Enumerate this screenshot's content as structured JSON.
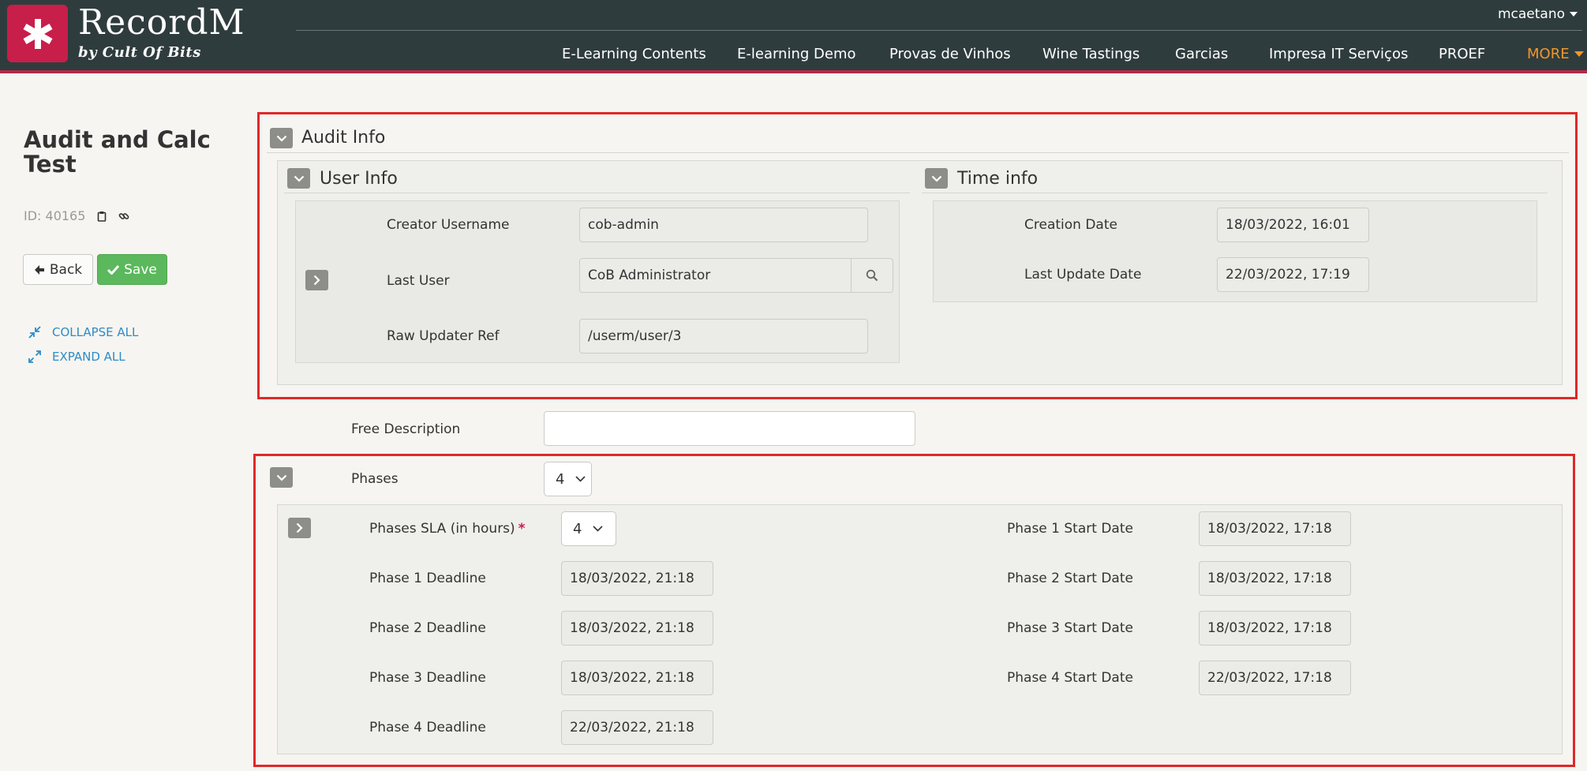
{
  "header": {
    "brand": "RecordM",
    "tagline": "by Cult Of Bits",
    "user": "mcaetano",
    "nav": [
      {
        "label": "E-Learning Contents"
      },
      {
        "label": "E-learning Demo"
      },
      {
        "label": "Provas de Vinhos"
      },
      {
        "label": "Wine Tastings"
      },
      {
        "label": "Garcias"
      },
      {
        "label": "Impresa IT Serviços"
      },
      {
        "label": "PROEF"
      }
    ],
    "more_label": "MORE"
  },
  "sidebar": {
    "title": "Audit and Calc Test",
    "id_label": "ID: 40165",
    "back_label": "Back",
    "save_label": "Save",
    "collapse_all": "COLLAPSE ALL",
    "expand_all": "EXPAND ALL"
  },
  "audit": {
    "title": "Audit Info",
    "user_info": {
      "title": "User Info",
      "creator_label": "Creator Username",
      "creator_value": "cob-admin",
      "last_user_label": "Last User",
      "last_user_value": "CoB Administrator",
      "raw_ref_label": "Raw Updater Ref",
      "raw_ref_value": "/userm/user/3"
    },
    "time_info": {
      "title": "Time info",
      "creation_label": "Creation Date",
      "creation_value": "18/03/2022, 16:01",
      "last_update_label": "Last Update Date",
      "last_update_value": "22/03/2022, 17:19"
    }
  },
  "free_description": {
    "label": "Free Description",
    "value": ""
  },
  "phases": {
    "label": "Phases",
    "value": "4",
    "sla_label": "Phases SLA (in hours)",
    "sla_required": "*",
    "sla_value": "4",
    "deadlines": [
      {
        "label": "Phase 1 Deadline",
        "value": "18/03/2022, 21:18"
      },
      {
        "label": "Phase 2 Deadline",
        "value": "18/03/2022, 21:18"
      },
      {
        "label": "Phase 3 Deadline",
        "value": "18/03/2022, 21:18"
      },
      {
        "label": "Phase 4 Deadline",
        "value": "22/03/2022, 21:18"
      }
    ],
    "start_dates": [
      {
        "label": "Phase 1 Start Date",
        "value": "18/03/2022, 17:18"
      },
      {
        "label": "Phase 2 Start Date",
        "value": "18/03/2022, 17:18"
      },
      {
        "label": "Phase 3 Start Date",
        "value": "18/03/2022, 17:18"
      },
      {
        "label": "Phase 4 Start Date",
        "value": "22/03/2022, 17:18"
      }
    ]
  },
  "colors": {
    "header_bg": "#2f3c3d",
    "brand_red": "#c81e4a",
    "save_green": "#5cb85c",
    "link_blue": "#2e8bc7",
    "more_orange": "#f0962a",
    "highlight_red": "#e02828"
  }
}
